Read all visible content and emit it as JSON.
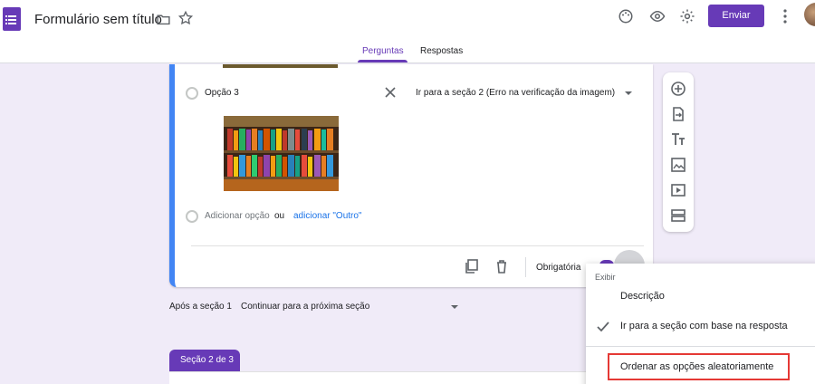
{
  "header": {
    "doc_title": "Formulário sem título",
    "send_label": "Enviar"
  },
  "tabs": [
    {
      "label": "Perguntas",
      "active": true
    },
    {
      "label": "Respostas",
      "active": false
    }
  ],
  "question": {
    "options": [
      {
        "label": "Opção 3",
        "goto": "Ir para a seção 2 (Erro na verificação da imagem)"
      }
    ],
    "add_option": "Adicionar opção",
    "or_text": "ou",
    "add_other": "adicionar \"Outro\"",
    "required_label": "Obrigatória"
  },
  "after_section": {
    "label": "Após a seção 1",
    "value": "Continuar para a próxima seção"
  },
  "section2": {
    "badge": "Seção 2 de 3"
  },
  "menu": {
    "header": "Exibir",
    "items": [
      {
        "label": "Descrição",
        "checked": false
      },
      {
        "label": "Ir para a seção com base na resposta",
        "checked": true
      },
      {
        "label": "Ordenar as opções aleatoriamente",
        "checked": false,
        "highlighted": true
      }
    ]
  },
  "colors": {
    "accent": "#673ab7",
    "focus_border": "#4285f4",
    "highlight": "#e53935"
  },
  "icons": [
    "folder-icon",
    "star-icon",
    "palette-icon",
    "eye-icon",
    "gear-icon",
    "more-vert-icon",
    "close-icon",
    "copy-icon",
    "trash-icon",
    "add-circle-icon",
    "import-icon",
    "title-icon",
    "image-icon",
    "video-icon",
    "section-icon",
    "check-icon"
  ]
}
